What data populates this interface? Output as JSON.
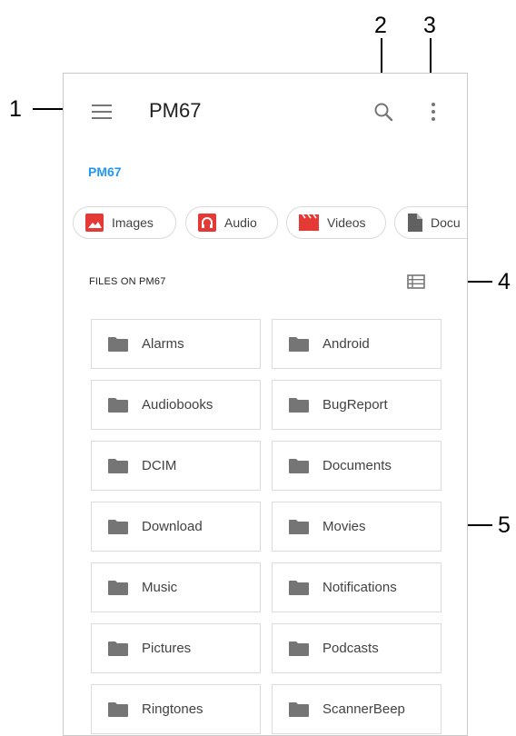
{
  "callouts": [
    "1",
    "2",
    "3",
    "4",
    "5"
  ],
  "appbar": {
    "title": "PM67"
  },
  "breadcrumb": "PM67",
  "chips": [
    {
      "label": "Images",
      "icon": "image-icon",
      "color": "#e53935"
    },
    {
      "label": "Audio",
      "icon": "headphones-icon",
      "color": "#e53935"
    },
    {
      "label": "Videos",
      "icon": "movie-icon",
      "color": "#e53935"
    },
    {
      "label": "Docu",
      "icon": "document-icon",
      "color": "#616161"
    }
  ],
  "section_title": "FILES ON PM67",
  "folders": [
    "Alarms",
    "Android",
    "Audiobooks",
    "BugReport",
    "DCIM",
    "Documents",
    "Download",
    "Movies",
    "Music",
    "Notifications",
    "Pictures",
    "Podcasts",
    "Ringtones",
    "ScannerBeep"
  ],
  "colors": {
    "accent": "#2196f3",
    "icon_grey": "#757575",
    "folder": "#757575"
  }
}
